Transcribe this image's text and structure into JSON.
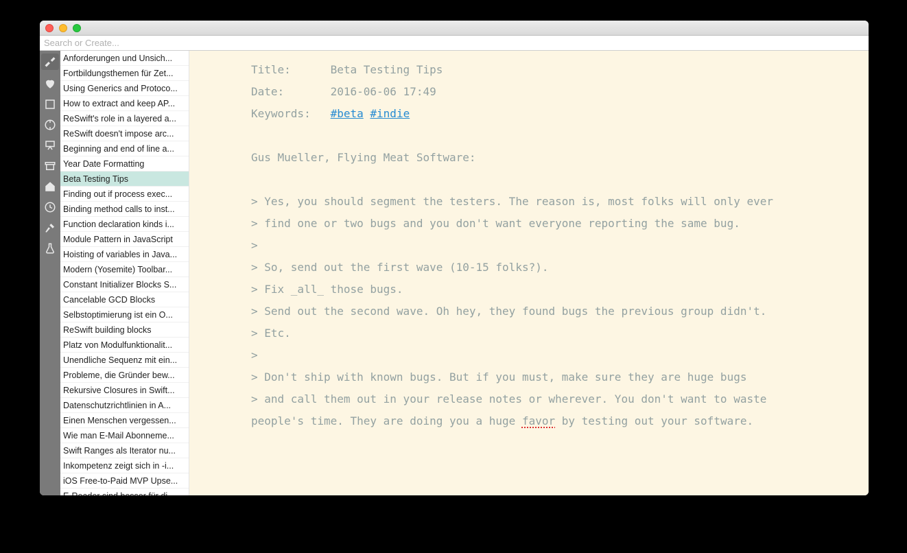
{
  "search": {
    "placeholder": "Search or Create..."
  },
  "notes": [
    "Anforderungen und Unsich...",
    "Fortbildungsthemen für Zet...",
    "Using Generics and Protoco...",
    "How to extract and keep AP...",
    "ReSwift's role in a layered a...",
    "ReSwift doesn't impose arc...",
    "Beginning and end of line a...",
    "Year Date Formatting",
    "Beta Testing Tips",
    "Finding out if process exec...",
    "Binding method calls to inst...",
    "Function declaration kinds i...",
    "Module Pattern in JavaScript",
    "Hoisting of variables in Java...",
    "Modern (Yosemite) Toolbar...",
    "Constant Initializer Blocks S...",
    "Cancelable GCD Blocks",
    "Selbstoptimierung ist ein O...",
    "ReSwift building blocks",
    "Platz von Modulfunktionalit...",
    "Unendliche Sequenz mit ein...",
    "Probleme, die Gründer bew...",
    "Rekursive Closures in Swift...",
    "Datenschutzrichtlinien in A...",
    "Einen Menschen vergessen...",
    "Wie man E-Mail Abonneme...",
    "Swift Ranges als Iterator nu...",
    "Inkompetenz zeigt sich in -i...",
    "iOS Free-to-Paid MVP Upse...",
    "E-Reader sind besser für di..."
  ],
  "selectedNoteIndex": 8,
  "note": {
    "meta": {
      "titleLabel": "Title:",
      "titleValue": "Beta Testing Tips",
      "dateLabel": "Date:",
      "dateValue": "2016-06-06 17:49",
      "keywordsLabel": "Keywords:",
      "keyword1": "#beta",
      "keyword2": "#indie"
    },
    "bodyIntro": "Gus Mueller, Flying Meat Software:",
    "quoteLines": [
      "> Yes, you should segment the testers. The reason is, most folks will only ever",
      "> find one or two bugs and you don't want everyone reporting the same bug.",
      ">",
      "> So, send out the first wave (10-15 folks?).",
      "> Fix _all_ those bugs.",
      "> Send out the second wave. Oh hey, they found bugs the previous group didn't.",
      "> Etc.",
      ">",
      "> Don't ship with known bugs. But if you must, make sure they are huge bugs",
      "> and call them out in your release notes or wherever. You don't want to waste"
    ],
    "trailingBefore": "people's time. They are doing you a huge ",
    "spellWord": "favor",
    "trailingAfter": " by testing out your software."
  },
  "icons": [
    "wrench-icon",
    "heart-icon",
    "book-icon",
    "compass-icon",
    "easel-icon",
    "archive-icon",
    "home-icon",
    "history-icon",
    "hammer-icon",
    "flask-icon"
  ]
}
